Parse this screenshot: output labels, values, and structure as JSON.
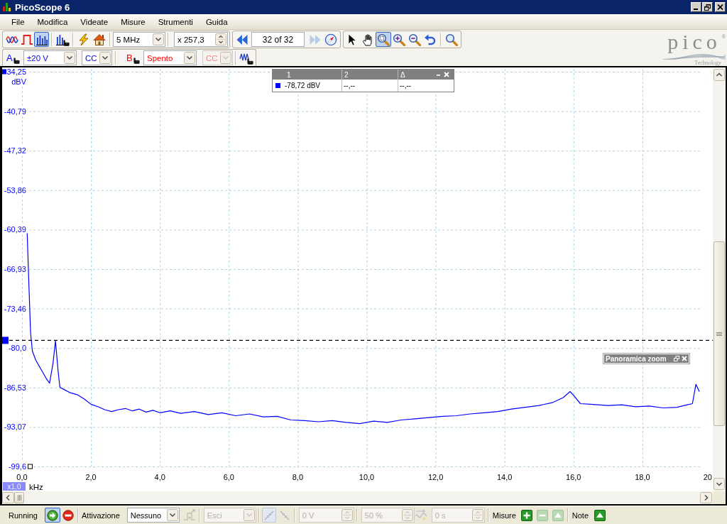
{
  "window": {
    "title": "PicoScope 6"
  },
  "menu": [
    "File",
    "Modifica",
    "Videate",
    "Misure",
    "Strumenti",
    "Guida"
  ],
  "toolbar": {
    "modes": [
      {
        "kind": "scope",
        "selected": false
      },
      {
        "kind": "persistence",
        "selected": false
      },
      {
        "kind": "spectrum",
        "selected": true
      }
    ],
    "timebase": "5 MHz",
    "zoom_factor": "x 257,3",
    "buffer": {
      "position": "32 of 32",
      "next_disabled": true
    },
    "tools": [
      {
        "kind": "pointer",
        "selected": false
      },
      {
        "kind": "hand",
        "selected": false
      },
      {
        "kind": "zoom_region",
        "selected": true
      },
      {
        "kind": "zoom_in",
        "selected": false
      },
      {
        "kind": "zoom_out",
        "selected": false
      }
    ],
    "channels": [
      {
        "name": "A",
        "color": "#0000ff",
        "range": "±20 V",
        "coupling": "CC",
        "coupling_disabled": false
      },
      {
        "name": "B",
        "color": "#ff0000",
        "range": "Spento",
        "coupling": "CC",
        "coupling_disabled": true
      }
    ]
  },
  "logo": {
    "name": "pico",
    "registered": "®",
    "tagline": "Technology"
  },
  "plot": {
    "rulers_table": {
      "columns": [
        "1",
        "2",
        "Δ"
      ],
      "rows": [
        {
          "color": "#0000ff",
          "cells": [
            "-78,72 dBV",
            "--,--",
            "--,--"
          ]
        }
      ]
    },
    "zoom_overview": {
      "title": "Panoramica zoom"
    },
    "axis_zoom": "x1,0",
    "chart_data": [
      {
        "type": "line",
        "xlabel": "kHz",
        "ylabel": "dBV",
        "color": "#0000ff",
        "grid": true,
        "xlim": [
          0,
          20
        ],
        "ylim": [
          -99.6,
          -34.25
        ],
        "xticks": [
          {
            "value": 0,
            "label": "0,0"
          },
          {
            "value": 2,
            "label": "2,0"
          },
          {
            "value": 4,
            "label": "4,0"
          },
          {
            "value": 6,
            "label": "6,0"
          },
          {
            "value": 8,
            "label": "8,0"
          },
          {
            "value": 10,
            "label": "10,0"
          },
          {
            "value": 12,
            "label": "12,0"
          },
          {
            "value": 14,
            "label": "14,0"
          },
          {
            "value": 16,
            "label": "16,0"
          },
          {
            "value": 18,
            "label": "18,0"
          },
          {
            "value": 20,
            "label": "20"
          }
        ],
        "yticks": [
          {
            "value": -34.25,
            "label": "34,25"
          },
          {
            "value": -40.79,
            "label": "-40,79"
          },
          {
            "value": -47.32,
            "label": "-47,32"
          },
          {
            "value": -53.86,
            "label": "-53,86"
          },
          {
            "value": -60.39,
            "label": "-60,39"
          },
          {
            "value": -66.93,
            "label": "-66,93"
          },
          {
            "value": -73.46,
            "label": "-73,46"
          },
          {
            "value": -80,
            "label": "-80,0"
          },
          {
            "value": -86.53,
            "label": "-86,53"
          },
          {
            "value": -93.07,
            "label": "-93,07"
          },
          {
            "value": -99.6,
            "label": "-99,6"
          }
        ],
        "ref_lines": [
          {
            "axis": "y",
            "value": -78.72,
            "color": "#000000",
            "line_style": "dashed"
          }
        ],
        "x": [
          0.15,
          0.2,
          0.25,
          0.3,
          0.4,
          0.55,
          0.7,
          0.8,
          0.9,
          0.97,
          1.05,
          1.1,
          1.2,
          1.4,
          1.6,
          1.8,
          2.0,
          2.2,
          2.4,
          2.6,
          2.8,
          3.0,
          3.2,
          3.4,
          3.6,
          3.8,
          4.0,
          4.3,
          4.6,
          5.0,
          5.4,
          5.8,
          6.2,
          6.6,
          7.0,
          7.4,
          7.8,
          8.2,
          8.6,
          9.0,
          9.4,
          9.8,
          10.2,
          10.6,
          11.0,
          11.4,
          11.8,
          12.2,
          12.6,
          13.0,
          13.4,
          13.8,
          14.2,
          14.6,
          15.0,
          15.4,
          15.7,
          15.9,
          16.0,
          16.2,
          16.5,
          17.0,
          17.4,
          17.8,
          18.2,
          18.6,
          19.0,
          19.3,
          19.45,
          19.55,
          19.65
        ],
        "values": [
          -61.0,
          -69.5,
          -77.5,
          -80.5,
          -82.0,
          -83.5,
          -85.0,
          -85.8,
          -82.5,
          -78.8,
          -84.0,
          -86.5,
          -86.8,
          -87.4,
          -87.7,
          -88.4,
          -89.3,
          -89.7,
          -90.2,
          -90.5,
          -90.2,
          -90.0,
          -90.4,
          -90.1,
          -90.6,
          -90.3,
          -90.7,
          -90.4,
          -90.8,
          -90.5,
          -91.0,
          -90.7,
          -91.2,
          -90.9,
          -91.4,
          -91.3,
          -91.9,
          -92.0,
          -92.2,
          -92.0,
          -92.3,
          -92.5,
          -92.1,
          -92.3,
          -91.9,
          -91.7,
          -91.5,
          -91.3,
          -91.2,
          -90.9,
          -90.7,
          -90.5,
          -90.1,
          -89.8,
          -89.5,
          -89.0,
          -88.2,
          -87.2,
          -87.8,
          -89.2,
          -89.3,
          -89.5,
          -89.4,
          -89.7,
          -89.6,
          -89.9,
          -89.8,
          -89.4,
          -89.2,
          -86.0,
          -87.2
        ]
      }
    ]
  },
  "status_bar": {
    "state": "Running",
    "capture_buttons": [
      {
        "kind": "run",
        "selected": true
      },
      {
        "kind": "stop",
        "selected": false
      }
    ],
    "trigger": {
      "label": "Attivazione",
      "mode": "Nessuno",
      "advanced_disabled": true,
      "type": {
        "value": "Esci",
        "disabled": true
      },
      "edges": [
        {
          "kind": "rising",
          "selected": true,
          "disabled": true
        },
        {
          "kind": "falling",
          "selected": false,
          "disabled": true
        }
      ],
      "threshold": {
        "value": "0 V",
        "disabled": true
      },
      "pretrigger": {
        "value": "50 %",
        "disabled": true
      },
      "delay": {
        "value": "0 s",
        "disabled": true
      }
    },
    "measurements": {
      "label": "Misure",
      "buttons": [
        {
          "kind": "add",
          "disabled": false
        },
        {
          "kind": "remove",
          "disabled": true
        },
        {
          "kind": "edit",
          "disabled": true
        }
      ]
    },
    "notes": {
      "label": "Note",
      "disabled": false
    }
  }
}
